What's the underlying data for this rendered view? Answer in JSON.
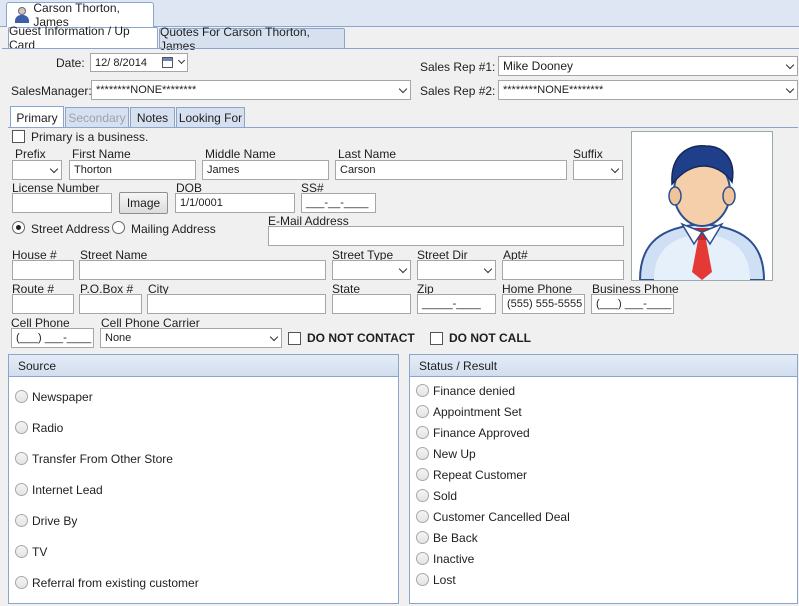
{
  "doc_tab": {
    "title": "Carson Thorton, James"
  },
  "main_tabs": [
    {
      "label": "Guest Information / Up Card"
    },
    {
      "label": "Quotes For Carson Thorton, James"
    }
  ],
  "header": {
    "date_label": "Date:",
    "date_value": "12/  8/2014",
    "sales_rep1_label": "Sales Rep #1:",
    "sales_rep1_value": "Mike Dooney",
    "sales_manager_label": "SalesManager:",
    "sales_manager_value": "********NONE********",
    "sales_rep2_label": "Sales Rep #2:",
    "sales_rep2_value": "********NONE********"
  },
  "sub_tabs": [
    {
      "label": "Primary"
    },
    {
      "label": "Secondary"
    },
    {
      "label": "Notes"
    },
    {
      "label": "Looking For"
    }
  ],
  "primary": {
    "is_business_label": "Primary is a business.",
    "prefix_label": "Prefix",
    "first_name_label": "First Name",
    "first_name_value": "Thorton",
    "middle_name_label": "Middle Name",
    "middle_name_value": "James",
    "last_name_label": "Last Name",
    "last_name_value": "Carson",
    "suffix_label": "Suffix",
    "license_label": "License Number",
    "image_button": "Image",
    "dob_label": "DOB",
    "dob_value": "1/1/0001",
    "ss_label": "SS#",
    "ss_value": "___-__-____",
    "street_address_label": "Street Address",
    "mailing_address_label": "Mailing Address",
    "email_label": "E-Mail Address",
    "house_label": "House #",
    "street_name_label": "Street Name",
    "street_type_label": "Street Type",
    "street_dir_label": "Street Dir",
    "apt_label": "Apt#",
    "route_label": "Route #",
    "pobox_label": "P.O.Box #",
    "city_label": "City",
    "state_label": "State",
    "zip_label": "Zip",
    "zip_value": "_____-____",
    "home_phone_label": "Home Phone",
    "home_phone_value": "(555) 555-5555",
    "business_phone_label": "Business Phone",
    "business_phone_value": "(___) ___-____",
    "cell_phone_label": "Cell Phone",
    "cell_phone_value": "(___) ___-____",
    "cell_carrier_label": "Cell Phone Carrier",
    "cell_carrier_value": "None",
    "do_not_contact_label": "DO NOT CONTACT",
    "do_not_call_label": "DO NOT CALL"
  },
  "source": {
    "title": "Source",
    "options": [
      "Newspaper",
      "Radio",
      "Transfer From Other Store",
      "Internet Lead",
      "Drive By",
      "TV",
      "Referral from existing customer"
    ]
  },
  "status": {
    "title": "Status / Result",
    "options": [
      "Finance denied",
      "Appointment Set",
      "Finance Approved",
      "New Up",
      "Repeat Customer",
      "Sold",
      "Customer Cancelled Deal",
      "Be Back",
      "Inactive",
      "Lost"
    ]
  },
  "icons": {
    "doc_tab": "user-icon",
    "photo": "person-avatar-icon",
    "date": "calendar-icon"
  }
}
